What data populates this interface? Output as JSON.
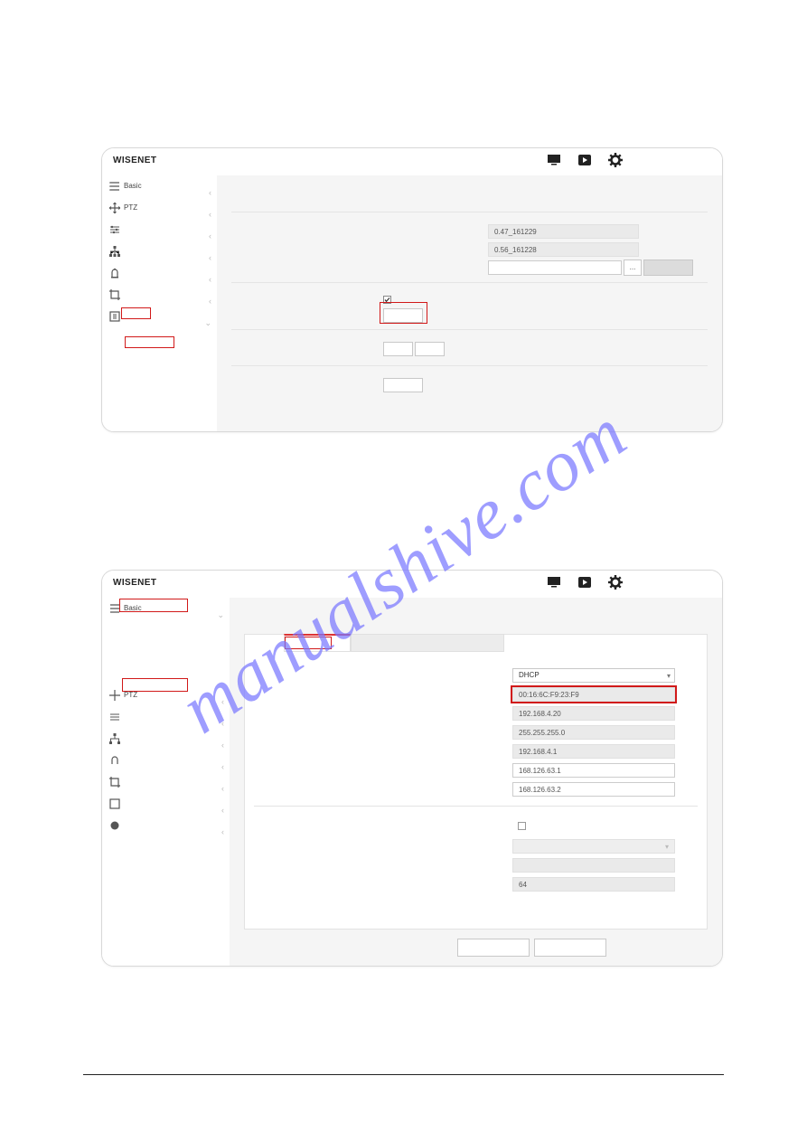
{
  "watermark": "manualshive.com",
  "brand": "WISENET",
  "win1": {
    "sidebar": {
      "items": [
        {
          "label": "Basic",
          "icon": "list-icon"
        },
        {
          "label": "PTZ",
          "icon": "move-icon"
        },
        {
          "label": "",
          "icon": "sliders-icon"
        },
        {
          "label": "",
          "icon": "network-icon"
        },
        {
          "label": "",
          "icon": "event-icon"
        },
        {
          "label": "",
          "icon": "crop-icon"
        },
        {
          "label": "",
          "icon": "system-icon"
        }
      ],
      "sub": {
        "label": ""
      }
    },
    "fields": {
      "sw": "0.47_161229",
      "hw": "0.56_161228",
      "file": "",
      "browse": "...",
      "upload": ""
    }
  },
  "win2": {
    "sidebar": {
      "items": [
        {
          "label": "Basic",
          "icon": "list-icon"
        },
        {
          "label": "",
          "icon": "sub-icon"
        },
        {
          "label": "",
          "icon": "sub-icon"
        },
        {
          "label": "",
          "icon": "sub-icon"
        },
        {
          "label": "PTZ",
          "icon": "move-icon"
        },
        {
          "label": "",
          "icon": "sliders-icon"
        },
        {
          "label": "",
          "icon": "network-icon"
        },
        {
          "label": "",
          "icon": "event-icon"
        },
        {
          "label": "",
          "icon": "crop-icon"
        },
        {
          "label": "",
          "icon": "analytics-icon"
        },
        {
          "label": "",
          "icon": "system-icon"
        }
      ]
    },
    "tabs": {
      "active": "",
      "inactive": ""
    },
    "net": {
      "type": "DHCP",
      "mac": "00:16:6C:F9:23:F9",
      "ip": "192.168.4.20",
      "mask": "255.255.255.0",
      "gw": "192.168.4.1",
      "dns1": "168.126.63.1",
      "dns2": "168.126.63.2",
      "v6prefix": "64"
    },
    "buttons": {
      "apply": "",
      "cancel": ""
    }
  }
}
